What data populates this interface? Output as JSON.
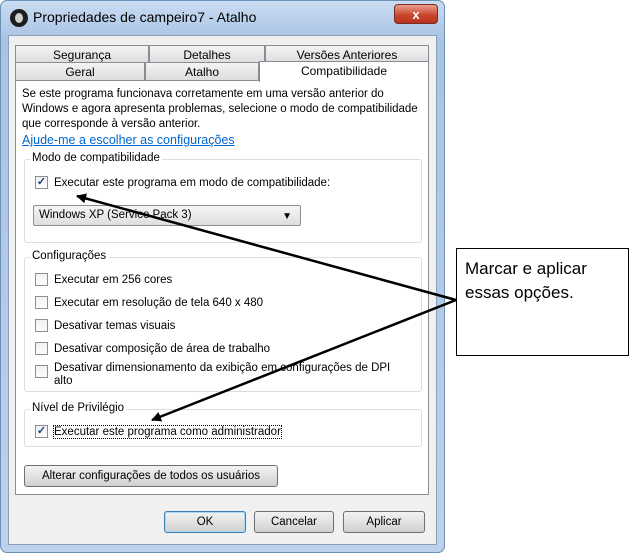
{
  "window": {
    "title": "Propriedades de campeiro7 - Atalho",
    "close_glyph": "x"
  },
  "tabs": {
    "row1": [
      "Segurança",
      "Detalhes",
      "Versões Anteriores"
    ],
    "row2": [
      "Geral",
      "Atalho",
      "Compatibilidade"
    ],
    "active": "Compatibilidade"
  },
  "intro": {
    "text": "Se este programa funcionava corretamente em uma versão anterior do Windows e agora apresenta problemas, selecione o modo de compatibilidade que corresponde à versão anterior.",
    "help_link": "Ajude-me a escolher as configurações"
  },
  "compat_mode": {
    "legend": "Modo de compatibilidade",
    "checkbox_label": "Executar este programa em modo de compatibilidade:",
    "checked": true,
    "selected_os": "Windows XP (Service Pack 3)"
  },
  "settings": {
    "legend": "Configurações",
    "items": [
      {
        "label": "Executar em 256 cores",
        "checked": false
      },
      {
        "label": "Executar em resolução de tela 640 x 480",
        "checked": false
      },
      {
        "label": "Desativar temas visuais",
        "checked": false
      },
      {
        "label": "Desativar composição de área de trabalho",
        "checked": false
      },
      {
        "label": "Desativar dimensionamento da exibição em configurações de DPI alto",
        "checked": false
      }
    ]
  },
  "privilege": {
    "legend": "Nível de Privilégio",
    "checkbox_label": "Executar este programa como administrador",
    "checked": true
  },
  "all_users_button": "Alterar configurações de todos os usuários",
  "buttons": {
    "ok": "OK",
    "cancel": "Cancelar",
    "apply": "Aplicar"
  },
  "callout": {
    "text": "Marcar e aplicar essas opções."
  },
  "check_glyph": "✓",
  "dropdown_glyph": "▼"
}
